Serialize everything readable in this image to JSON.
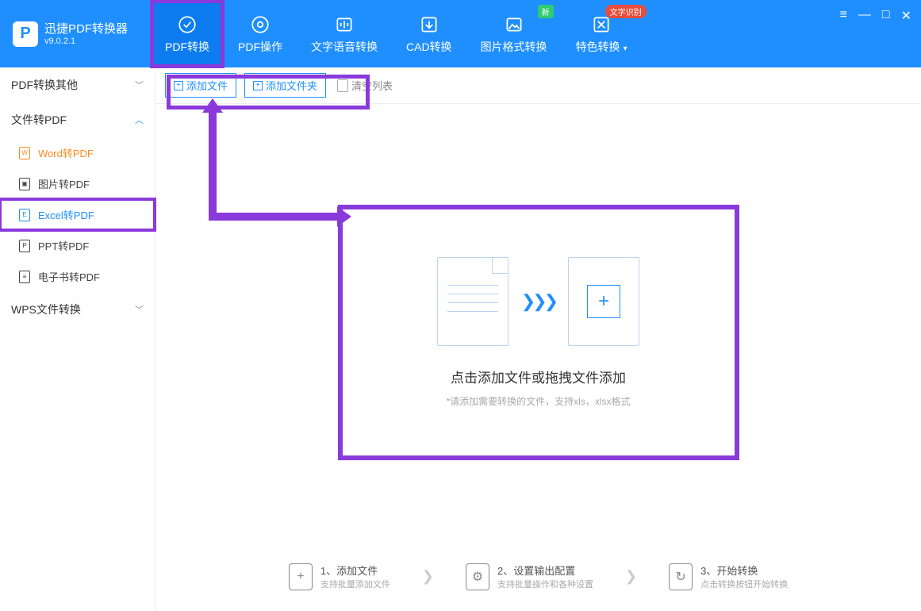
{
  "app": {
    "title": "迅捷PDF转换器",
    "version": "v9.0.2.1"
  },
  "tabs": [
    {
      "label": "PDF转换",
      "icon": "convert"
    },
    {
      "label": "PDF操作",
      "icon": "operate"
    },
    {
      "label": "文字语音转换",
      "icon": "audio"
    },
    {
      "label": "CAD转换",
      "icon": "cad"
    },
    {
      "label": "图片格式转换",
      "icon": "image",
      "badge_new": "新"
    },
    {
      "label": "特色转换",
      "icon": "special",
      "badge_red": "文字识别",
      "caret": true
    }
  ],
  "sidebar": {
    "groups": [
      {
        "label": "PDF转换其他",
        "open": false
      },
      {
        "label": "文件转PDF",
        "open": true,
        "items": [
          {
            "label": "Word转PDF",
            "mark": "W"
          },
          {
            "label": "图片转PDF",
            "mark": "I"
          },
          {
            "label": "Excel转PDF",
            "mark": "E",
            "selected": true
          },
          {
            "label": "PPT转PDF",
            "mark": "P"
          },
          {
            "label": "电子书转PDF",
            "mark": "B"
          }
        ]
      },
      {
        "label": "WPS文件转换",
        "open": false
      }
    ]
  },
  "toolbar": {
    "add_file": "添加文件",
    "add_folder": "添加文件夹",
    "clear_list": "清空列表"
  },
  "drop": {
    "title": "点击添加文件或拖拽文件添加",
    "sub": "*请添加需要转换的文件，支持xls，xlsx格式"
  },
  "steps": [
    {
      "num": "1、",
      "title": "添加文件",
      "sub": "支持批量添加文件"
    },
    {
      "num": "2、",
      "title": "设置输出配置",
      "sub": "支持批量操作和各种设置"
    },
    {
      "num": "3、",
      "title": "开始转换",
      "sub": "点击转换按钮开始转换"
    }
  ]
}
